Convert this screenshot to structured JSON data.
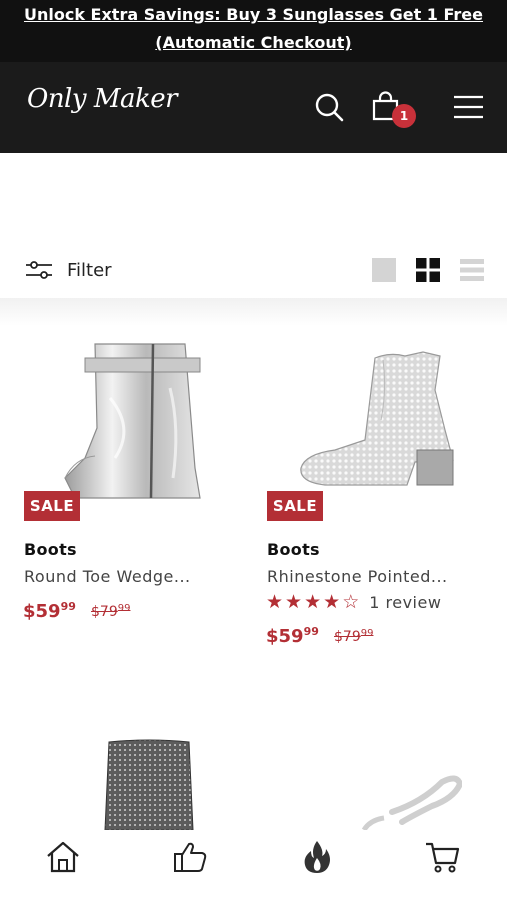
{
  "promo": {
    "line1": "Unlock Extra Savings: Buy 3 Sunglasses Get 1 Free",
    "line2": "(Automatic Checkout)"
  },
  "header": {
    "logo": "Only Maker",
    "cart_count": "1",
    "icons": [
      "search-icon",
      "bag-icon",
      "menu-icon"
    ]
  },
  "filter": {
    "label": "Filter",
    "views": [
      "single-view-icon",
      "grid-view-icon",
      "list-view-icon"
    ]
  },
  "products": [
    {
      "badge": "SALE",
      "type": "Boots",
      "name": "Round Toe Wedge...",
      "price_main": "$59",
      "price_cents": "99",
      "old_main": "$79",
      "old_cents": "99"
    },
    {
      "badge": "SALE",
      "type": "Boots",
      "name": "Rhinestone Pointed...",
      "rating": 4,
      "review": "1 review",
      "price_main": "$59",
      "price_cents": "99",
      "old_main": "$79",
      "old_cents": "99"
    }
  ],
  "bottom_nav": [
    "home-icon",
    "thumbs-up-icon",
    "fire-icon",
    "cart-icon"
  ],
  "colors": {
    "accent": "#b32f35",
    "header_bg": "#1b1b1b",
    "promo_bg": "#111111"
  }
}
